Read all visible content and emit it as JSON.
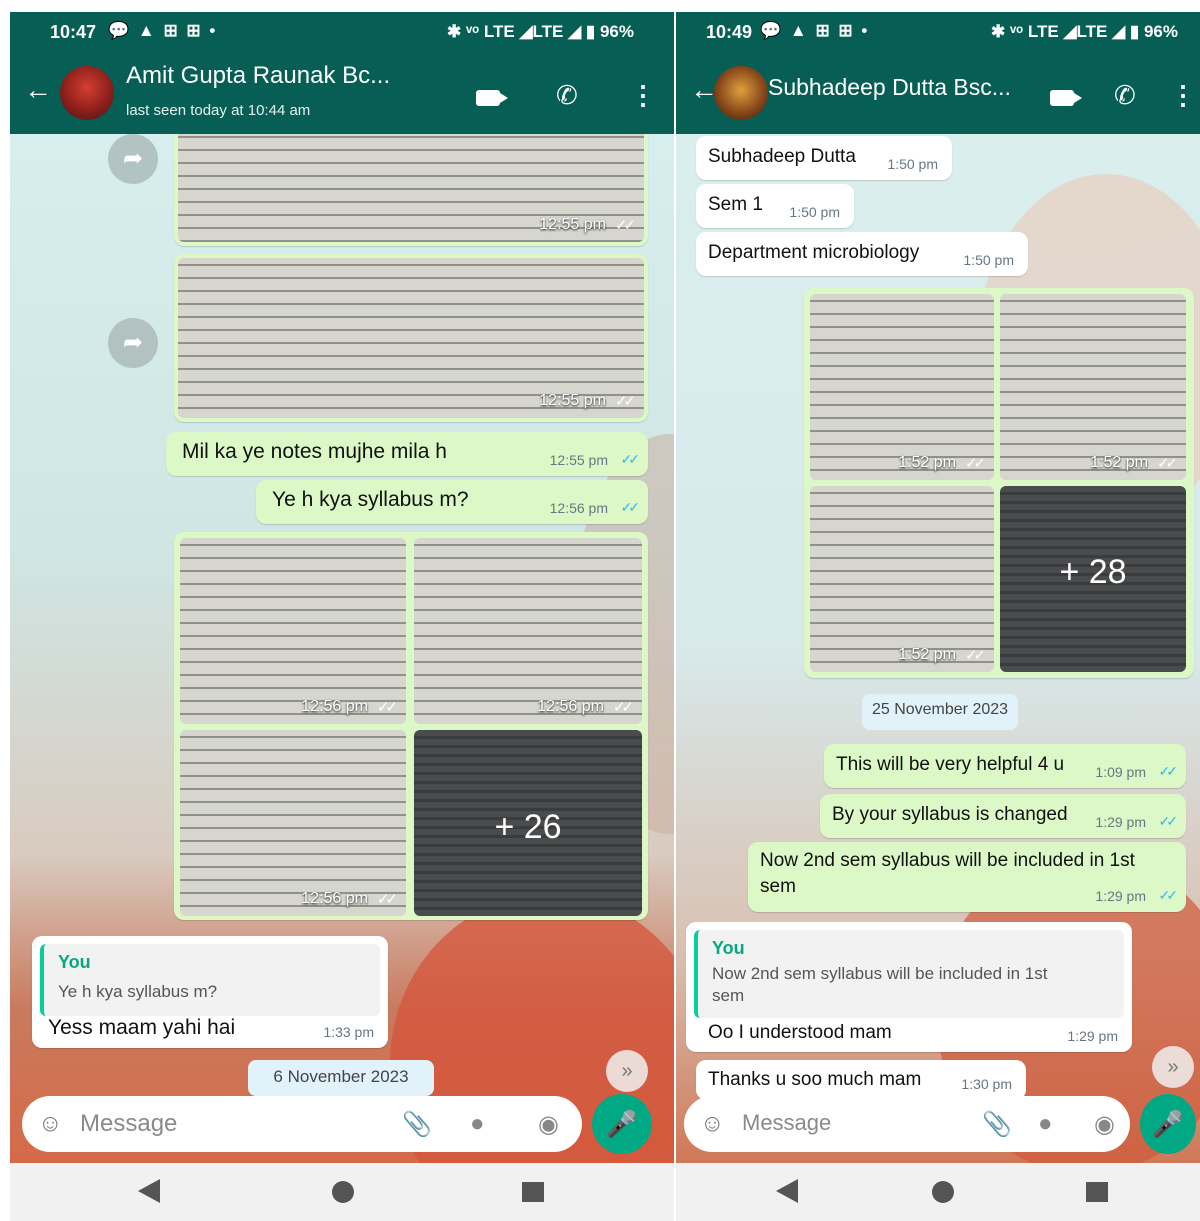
{
  "left": {
    "status": {
      "time": "10:47",
      "icons": "💬 ▲ ⊞ ⊞ •",
      "right": "✱ ᵛᵒ LTE ◢LTE ◢ ▮ 96%"
    },
    "header": {
      "name": "Amit Gupta Raunak Bc...",
      "status": "last seen today at 10:44 am"
    },
    "messages": {
      "photo1_time": "12:55 pm",
      "photo2_time": "12:55 pm",
      "m1": {
        "text": "Mil ka ye notes mujhe mila h",
        "time": "12:55 pm"
      },
      "m2": {
        "text": "Ye h kya syllabus m?",
        "time": "12:56 pm"
      },
      "grid_times": [
        "12:56 pm",
        "12:56 pm",
        "12:56 pm"
      ],
      "grid_more": "+ 26",
      "reply": {
        "quote_name": "You",
        "quote_text": "Ye h kya syllabus m?",
        "text": "Yess maam yahi hai",
        "time": "1:33 pm"
      }
    },
    "date_chip": "6 November 2023",
    "input": {
      "placeholder": "Message"
    }
  },
  "right": {
    "status": {
      "time": "10:49",
      "icons": "💬 ▲ ⊞ ⊞ •",
      "right": "✱ ᵛᵒ LTE ◢LTE ◢ ▮ 96%"
    },
    "header": {
      "name": "Subhadeep Dutta Bsc..."
    },
    "messages": {
      "in1": {
        "text": "Subhadeep Dutta",
        "time": "1:50 pm"
      },
      "in2": {
        "text": "Sem 1",
        "time": "1:50 pm"
      },
      "in3": {
        "text": "Department microbiology",
        "time": "1:50 pm"
      },
      "grid_times": [
        "1:52 pm",
        "1:52 pm",
        "1:52 pm"
      ],
      "grid_more": "+ 28",
      "o1": {
        "text": "This will be very helpful 4 u",
        "time": "1:09 pm"
      },
      "o2": {
        "text": "By your syllabus is changed",
        "time": "1:29 pm"
      },
      "o3": {
        "text_line1": "Now 2nd sem syllabus will be included in 1st",
        "text_line2": "sem",
        "time": "1:29 pm"
      },
      "reply": {
        "quote_name": "You",
        "quote_line1": "Now 2nd sem syllabus will be included in 1st",
        "quote_line2": "sem",
        "text": "Oo I understood mam",
        "time": "1:29 pm"
      },
      "in4": {
        "text": "Thanks u soo much mam",
        "time": "1:30 pm"
      }
    },
    "date_chip": "25 November 2023",
    "input": {
      "placeholder": "Message"
    }
  }
}
